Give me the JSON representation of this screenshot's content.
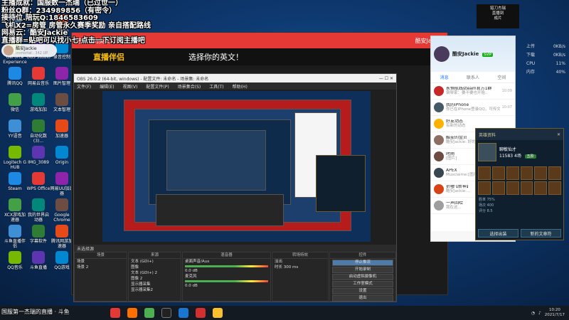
{
  "overlay": {
    "line1": "主播成就：国服数一杰瑞（已过世一）",
    "line2": "粉丝Q群：234989856（有密令）",
    "line3": "接待位.陪玩Q:1846583609",
    "line4": "飞机X2=房管 房管永久赛季奖励 亲自搭配路线",
    "line5": "网易云：酷安Jackie",
    "line6": "直播群=贴吧可以找小七 点击一下订阅主播吧"
  },
  "user_chip": {
    "name": "酷安Jackie",
    "sub": "immortal · 342 UP"
  },
  "desktop_icons": [
    "Internet Explorer",
    "小黑声网加速器",
    "Adobe Creati...",
    "GeForce Experience",
    "OBS Studio",
    "录音控制",
    "腾讯QQ",
    "网易云音乐",
    "图片智理",
    "微信",
    "游戏加加",
    "文本智理",
    "YY语音",
    "自动化数(3)...",
    "加速器",
    "Logitech G HUB",
    "IMG_3089",
    "Origin",
    "Steam",
    "WPS Office",
    "网易UU加速器",
    "XCX游戏加速器",
    "我的世界启动器",
    "Google Chrome",
    "斗鱼直播伴侣",
    "字幕软件",
    "腾讯网游加速器",
    "QQ音乐",
    "斗鱼直播",
    "QQ游戏"
  ],
  "browser": {
    "tab": "选择你的英文！",
    "brand": "直播伴侣",
    "user": "酷安Jackie",
    "headline": "选择你的英文！"
  },
  "qq": {
    "name": "酷安Jackie",
    "badge": "SVIP",
    "tabs": [
      "消息",
      "联系人",
      "空间"
    ],
    "items": [
      {
        "title": "永恒航线steam官方1群",
        "preview": "钢琴家：要不要也开始..",
        "time": "10:09",
        "color": "#c62828"
      },
      {
        "title": "我的iPhone",
        "preview": "你已在iPhone登录QQ，可传文件到...",
        "time": "10:07",
        "color": "#455a64"
      },
      {
        "title": "好友动态",
        "preview": "有新的动态",
        "time": "",
        "color": "#ffb300"
      },
      {
        "title": "酷安的金贝",
        "preview": "酷安Jackie: 好的",
        "time": "09:58",
        "color": "#8d6e63"
      },
      {
        "title": "时雨",
        "preview": "[图片]",
        "time": "09:42",
        "color": "#6d4c41"
      },
      {
        "title": "APEX",
        "preview": "Musclaime:[图片]",
        "time": "09:30",
        "color": "#37474f"
      },
      {
        "title": "折嗷·【新神】",
        "preview": "酷安Jackie:...",
        "time": "09:12",
        "color": "#d84315"
      },
      {
        "title": "一声回哈",
        "preview": "我在这...",
        "time": "",
        "color": "#9e9e9e"
      }
    ]
  },
  "game": {
    "title": "英雄资料",
    "hero_name": "聊敏仙才",
    "level": "11583",
    "rank": "4场",
    "badge": "五阶",
    "stats": [
      "胜率 75%",
      "场次 400",
      "评分 8.5"
    ],
    "buttons": [
      "选择出装",
      "新的文章符"
    ]
  },
  "notif": {
    "line1": "猎刀杰瑞",
    "line2": "直播到",
    "line3": "成片"
  },
  "netstat": [
    [
      "上传",
      "0KB/s"
    ],
    [
      "下载",
      "0KB/s"
    ],
    [
      "CPU",
      "11%"
    ],
    [
      "内存",
      "40%"
    ]
  ],
  "obs": {
    "title": "OBS 26.0.2 (64-bit, windows) - 配置文件: 未命名 - 场景集: 未命名",
    "menu": [
      "文件(F)",
      "编辑(E)",
      "视图(V)",
      "配置文件(P)",
      "场景集合(S)",
      "工具(T)",
      "帮助(H)"
    ],
    "mixer_label": "未选择源",
    "scenes_title": "场景",
    "scenes": [
      "场景",
      "场景 2"
    ],
    "sources_title": "来源",
    "sources": [
      "文本 (GDI+)",
      "图像",
      "文本 (GDI+) 2",
      "图像 2",
      "显示器采集",
      "显示器采集2"
    ],
    "audio_title": "混音器",
    "audio": [
      {
        "name": "桌面声音/Aux",
        "db": "0.0 dB"
      },
      {
        "name": "麦克风",
        "db": "0.0 dB"
      }
    ],
    "trans_title": "转场特效",
    "trans": [
      "淡出",
      "时长 300 ms"
    ],
    "controls_title": "控件",
    "controls": [
      "停止推流",
      "开始录制",
      "启动虚拟摄像机",
      "工作室模式",
      "设置",
      "退出"
    ]
  },
  "taskbar": {
    "watermark": "国服第一杰瑞的直播 · 斗鱼",
    "time": "10:20",
    "date": "2021/7/17"
  }
}
